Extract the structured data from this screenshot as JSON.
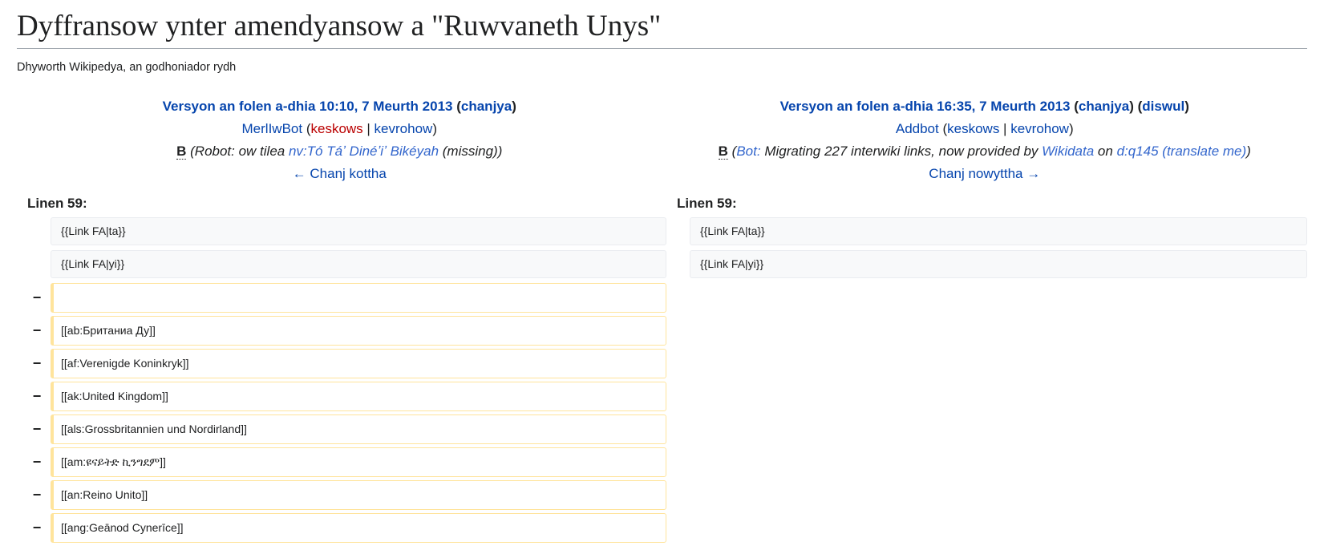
{
  "page": {
    "title": "Dyffransow ynter amendyansow a \"Ruwvaneth Unys\"",
    "subtitle": "Dhyworth Wikipedya, an godhoniador rydh"
  },
  "old": {
    "version_link": "Versyon an folen a-dhia 10:10, 7 Meurth 2013",
    "edit_link": "chanjya",
    "user": "MerlIwBot",
    "talk": "keskows",
    "contribs": "kevrohow",
    "bot_flag": "B",
    "summary_pre": "(Robot: ow tilea ",
    "summary_link": "nv:Tó Táʼ Dinéʼiʼ Bikéyah",
    "summary_post": " (missing))",
    "nav": "← Chanj kottha",
    "line_label": "Linen 59:",
    "context": [
      "{{Link FA|ta}}",
      "{{Link FA|yi}}"
    ],
    "removed": [
      "",
      "[[ab:Британиа Ду]]",
      "[[af:Verenigde Koninkryk]]",
      "[[ak:United Kingdom]]",
      "[[als:Grossbritannien und Nordirland]]",
      "[[am:ዩናይትድ ኪንግደም]]",
      "[[an:Reino Unito]]",
      "[[ang:Geānod Cynerīce]]"
    ],
    "removed_marker": "−"
  },
  "new": {
    "version_link": "Versyon an folen a-dhia 16:35, 7 Meurth 2013",
    "edit_link": "chanjya",
    "undo_link": "diswul",
    "user": "Addbot",
    "talk": "keskows",
    "contribs": "kevrohow",
    "bot_flag": "B",
    "summary_bot": "Bot:",
    "summary_mid": " Migrating 227 interwiki links, now provided by ",
    "summary_wikidata": "Wikidata",
    "summary_on": " on ",
    "summary_item": "d:q145 (translate me)",
    "nav": "Chanj nowyttha →",
    "line_label": "Linen 59:",
    "context": [
      "{{Link FA|ta}}",
      "{{Link FA|yi}}"
    ]
  },
  "colors": {
    "link": "#0645ad",
    "redlink": "#ba0000",
    "removed_border": "#ffe49c",
    "context_bg": "#f8f9fa"
  }
}
